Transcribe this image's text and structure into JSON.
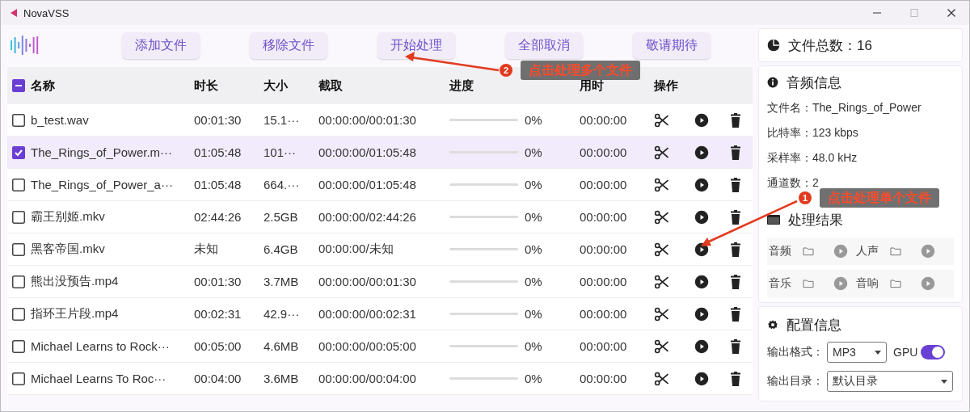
{
  "window": {
    "title": "NovaVSS"
  },
  "toolbar": {
    "buttons": [
      "添加文件",
      "移除文件",
      "开始处理",
      "全部取消",
      "敬请期待"
    ]
  },
  "table": {
    "header_indeterminate": true,
    "columns": [
      "名称",
      "时长",
      "大小",
      "截取",
      "进度",
      "用时",
      "操作"
    ],
    "rows": [
      {
        "name": "b_test.wav",
        "duration": "00:01:30",
        "size": "15.1···",
        "clip": "00:00:00/00:01:30",
        "level": 0,
        "percent": "0%",
        "elapsed": "00:00:00",
        "checked": false,
        "selected": false
      },
      {
        "name": "The_Rings_of_Power.m···",
        "duration": "01:05:48",
        "size": "101···",
        "clip": "00:00:00/01:05:48",
        "level": 0,
        "percent": "0%",
        "elapsed": "00:00:00",
        "checked": true,
        "selected": true
      },
      {
        "name": "The_Rings_of_Power_a···",
        "duration": "01:05:48",
        "size": "664.···",
        "clip": "00:00:00/01:05:48",
        "level": 0,
        "percent": "0%",
        "elapsed": "00:00:00",
        "checked": false,
        "selected": false
      },
      {
        "name": "霸王别姬.mkv",
        "duration": "02:44:26",
        "size": "2.5GB",
        "clip": "00:00:00/02:44:26",
        "level": 0,
        "percent": "0%",
        "elapsed": "00:00:00",
        "checked": false,
        "selected": false
      },
      {
        "name": "黑客帝国.mkv",
        "duration": "未知",
        "size": "6.4GB",
        "clip": "00:00:00/未知",
        "level": 0,
        "percent": "0%",
        "elapsed": "00:00:00",
        "checked": false,
        "selected": false
      },
      {
        "name": "熊出没预告.mp4",
        "duration": "00:01:30",
        "size": "3.7MB",
        "clip": "00:00:00/00:01:30",
        "level": 0,
        "percent": "0%",
        "elapsed": "00:00:00",
        "checked": false,
        "selected": false
      },
      {
        "name": "指环王片段.mp4",
        "duration": "00:02:31",
        "size": "42.9···",
        "clip": "00:00:00/00:02:31",
        "level": 0,
        "percent": "0%",
        "elapsed": "00:00:00",
        "checked": false,
        "selected": false
      },
      {
        "name": "Michael Learns to Rock···",
        "duration": "00:05:00",
        "size": "4.6MB",
        "clip": "00:00:00/00:05:00",
        "level": 0,
        "percent": "0%",
        "elapsed": "00:00:00",
        "checked": false,
        "selected": false
      },
      {
        "name": "Michael Learns To Roc···",
        "duration": "00:04:00",
        "size": "3.6MB",
        "clip": "00:00:00/00:04:00",
        "level": 0,
        "percent": "0%",
        "elapsed": "00:00:00",
        "checked": false,
        "selected": false
      }
    ]
  },
  "side": {
    "file_count": "文件总数：16",
    "audio_info": {
      "title": "音频信息",
      "lines": [
        "文件名：The_Rings_of_Power",
        "比特率：123 kbps",
        "采样率：48.0 kHz",
        "通道数：2"
      ]
    },
    "results": {
      "title": "处理结果",
      "items": [
        "音频",
        "人声",
        "音乐",
        "音响"
      ]
    },
    "config": {
      "title": "配置信息",
      "format_label": "输出格式：",
      "format_value": "MP3",
      "gpu_label": "GPU",
      "gpu_on": true,
      "dir_label": "输出目录：",
      "dir_value": "默认目录"
    }
  },
  "annotations": [
    {
      "number": "2",
      "text": "点击处理多个文件"
    },
    {
      "number": "1",
      "text": "点击处理单个文件"
    }
  ]
}
